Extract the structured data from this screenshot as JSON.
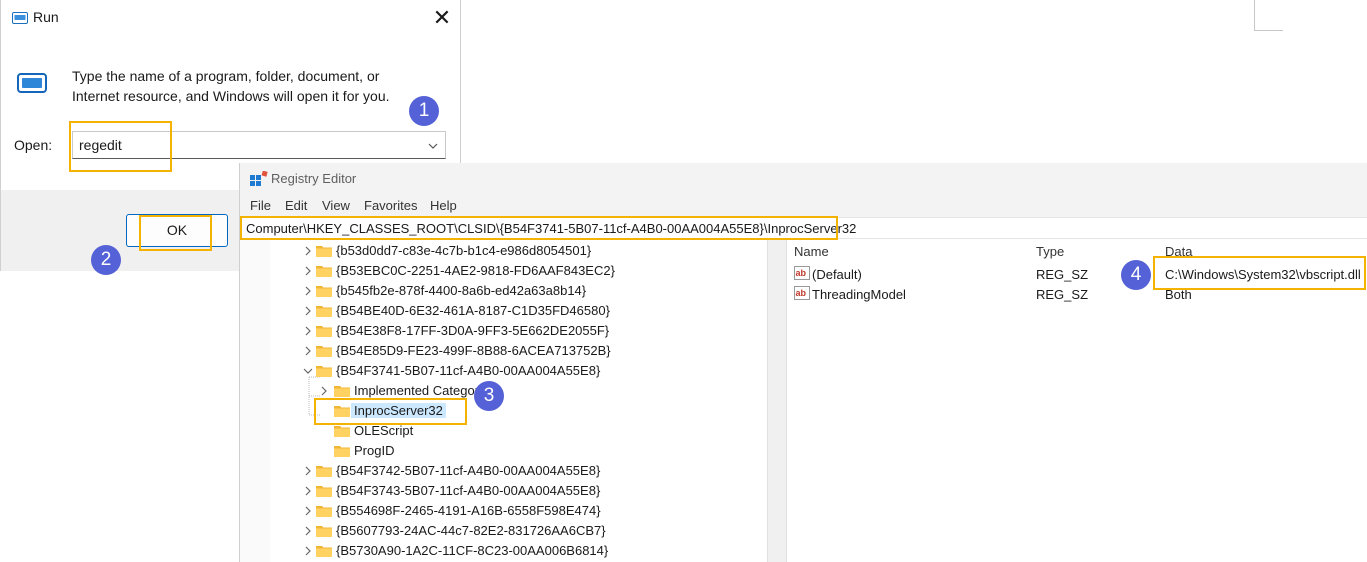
{
  "run_dialog": {
    "title": "Run",
    "close_glyph": "✕",
    "description": "Type the name of a program, folder, document, or Internet resource, and Windows will open it for you.",
    "open_label": "Open:",
    "open_value": "regedit",
    "ok_label": "OK"
  },
  "registry_editor": {
    "title": "Registry Editor",
    "menu": [
      "File",
      "Edit",
      "View",
      "Favorites",
      "Help"
    ],
    "address": "Computer\\HKEY_CLASSES_ROOT\\CLSID\\{B54F3741-5B07-11cf-A4B0-00AA004A55E8}\\InprocServer32",
    "tree": [
      {
        "label": "{b53d0dd7-c83e-4c7b-b1c4-e986d8054501}",
        "level": 0,
        "expander": "collapsed"
      },
      {
        "label": "{B53EBC0C-2251-4AE2-9818-FD6AAF843EC2}",
        "level": 0,
        "expander": "collapsed"
      },
      {
        "label": "{b545fb2e-878f-4400-8a6b-ed42a63a8b14}",
        "level": 0,
        "expander": "collapsed"
      },
      {
        "label": "{B54BE40D-6E32-461A-8187-C1D35FD46580}",
        "level": 0,
        "expander": "collapsed"
      },
      {
        "label": "{B54E38F8-17FF-3D0A-9FF3-5E662DE2055F}",
        "level": 0,
        "expander": "collapsed"
      },
      {
        "label": "{B54E85D9-FE23-499F-8B88-6ACEA713752B}",
        "level": 0,
        "expander": "collapsed"
      },
      {
        "label": "{B54F3741-5B07-11cf-A4B0-00AA004A55E8}",
        "level": 0,
        "expander": "expanded"
      },
      {
        "label": "Implemented Categories",
        "level": 1,
        "expander": "collapsed"
      },
      {
        "label": "InprocServer32",
        "level": 1,
        "expander": "none",
        "selected": true
      },
      {
        "label": "OLEScript",
        "level": 1,
        "expander": "none"
      },
      {
        "label": "ProgID",
        "level": 1,
        "expander": "none"
      },
      {
        "label": "{B54F3742-5B07-11cf-A4B0-00AA004A55E8}",
        "level": 0,
        "expander": "collapsed"
      },
      {
        "label": "{B54F3743-5B07-11cf-A4B0-00AA004A55E8}",
        "level": 0,
        "expander": "collapsed"
      },
      {
        "label": "{B554698F-2465-4191-A16B-6558F598E474}",
        "level": 0,
        "expander": "collapsed"
      },
      {
        "label": "{B5607793-24AC-44c7-82E2-831726AA6CB7}",
        "level": 0,
        "expander": "collapsed"
      },
      {
        "label": "{B5730A90-1A2C-11CF-8C23-00AA006B6814}",
        "level": 0,
        "expander": "collapsed"
      }
    ],
    "columns": {
      "name": "Name",
      "type": "Type",
      "data": "Data"
    },
    "values": [
      {
        "name": "(Default)",
        "type": "REG_SZ",
        "data": "C:\\Windows\\System32\\vbscript.dll"
      },
      {
        "name": "ThreadingModel",
        "type": "REG_SZ",
        "data": "Both"
      }
    ]
  },
  "annotations": {
    "steps": [
      "1",
      "2",
      "3",
      "4"
    ],
    "highlight_color": "#f4b300",
    "badge_color": "#5561d6"
  }
}
